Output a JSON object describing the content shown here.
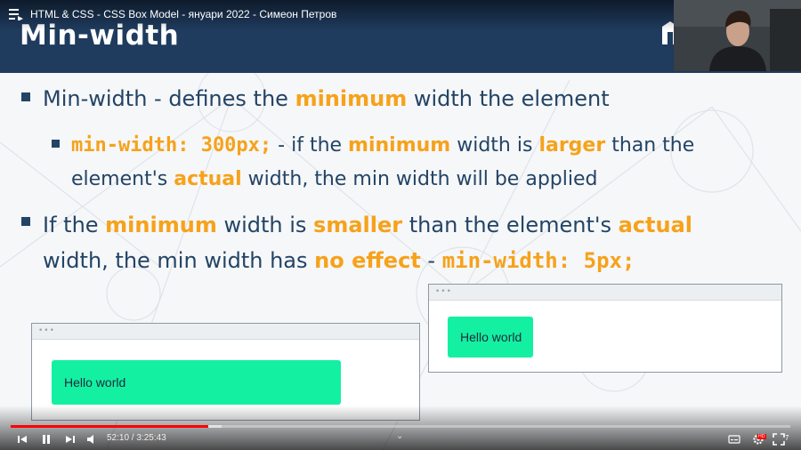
{
  "video": {
    "title": "HTML & CSS - CSS Box Model - януари 2022 - Симеон Петров",
    "current_time": "52:10",
    "duration": "3:25:43",
    "time_display": "52:10 / 3:25:43",
    "progress_fraction": 0.253,
    "buffered_fraction": 0.27,
    "playback_speed_label": "7"
  },
  "slide": {
    "title": "Min-width",
    "bullet1": {
      "p1": "Min-width - defines the ",
      "h1": "minimum",
      "p2": " width the element"
    },
    "bullet2": {
      "code": "min-width: 300px;",
      "p1": " - if the ",
      "h1": "minimum",
      "p2": " width is ",
      "h2": "larger",
      "p3": " than the element's ",
      "h3": "actual",
      "p4": " width, the min width will be applied"
    },
    "bullet3": {
      "p1": "If the ",
      "h1": "minimum",
      "p2": " width is ",
      "h2": "smaller",
      "p3": " than the element's ",
      "h3": "actual",
      "p4": " width, the min width has ",
      "h4": "no effect",
      "p5": " - ",
      "code": "min-width: 5px;"
    },
    "demo_left": {
      "dots": "•••",
      "label": "Hello world"
    },
    "demo_right": {
      "dots": "•••",
      "label": "Hello world"
    }
  },
  "icons": {
    "playlist": "playlist-icon",
    "watch_later": "clock-icon",
    "share": "share-icon",
    "prev": "skip-previous-icon",
    "pause": "pause-icon",
    "next": "skip-next-icon",
    "volume": "volume-icon",
    "subtitles": "subtitles-icon",
    "settings": "settings-gear-icon",
    "fullscreen": "fullscreen-icon",
    "chevron": "chevron-down-icon"
  },
  "colors": {
    "header": "#1f3b5e",
    "text": "#234465",
    "highlight": "#f6a21a",
    "demo_box": "#13f0a2",
    "progress": "#ff0000"
  }
}
